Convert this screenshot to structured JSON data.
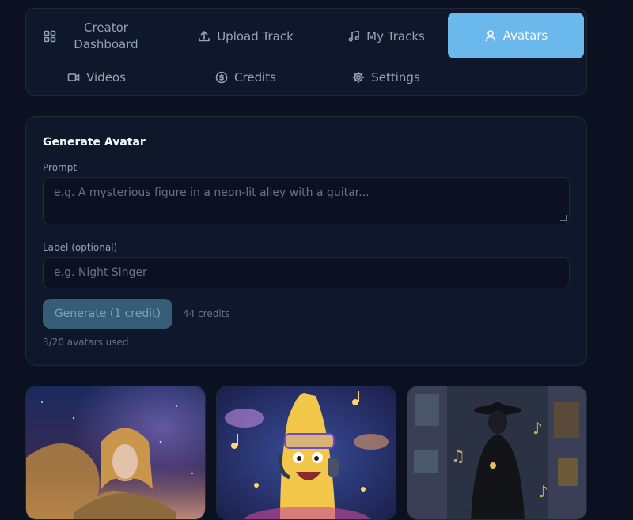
{
  "nav": {
    "tabs": [
      {
        "label": "Creator Dashboard",
        "icon": "grid-icon"
      },
      {
        "label": "Upload Track",
        "icon": "upload-icon"
      },
      {
        "label": "My Tracks",
        "icon": "music-note-icon"
      },
      {
        "label": "Avatars",
        "icon": "user-icon",
        "active": true
      },
      {
        "label": "Videos",
        "icon": "video-icon"
      },
      {
        "label": "Credits",
        "icon": "dollar-coin-icon"
      },
      {
        "label": "Settings",
        "icon": "gear-icon"
      }
    ]
  },
  "generate": {
    "title": "Generate Avatar",
    "prompt_label": "Prompt",
    "prompt_placeholder": "e.g. A mysterious figure in a neon-lit alley with a guitar...",
    "label_label": "Label (optional)",
    "label_placeholder": "e.g. Night Singer",
    "button_label": "Generate (1 credit)",
    "credits_text": "44 credits",
    "usage_text": "3/20 avatars used"
  },
  "gallery": [
    {
      "name": "avatar-cosmic-woman"
    },
    {
      "name": "avatar-banana-dj"
    },
    {
      "name": "avatar-night-figure"
    }
  ],
  "colors": {
    "accent": "#6ab8ec",
    "background": "#0b1120",
    "panel": "#0f172a",
    "button_disabled": "#355d78"
  }
}
